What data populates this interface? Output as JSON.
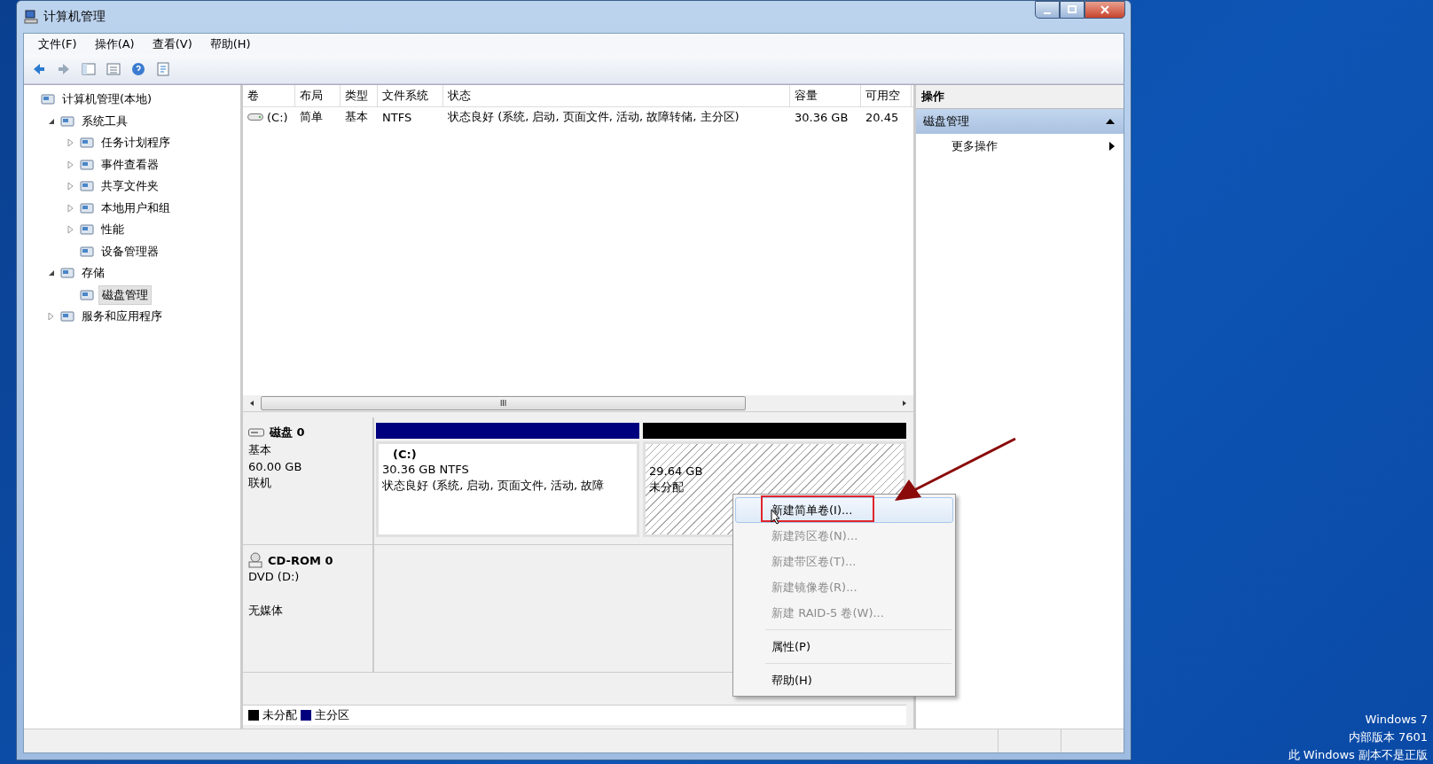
{
  "window": {
    "title": "计算机管理"
  },
  "menu": [
    {
      "label": "文件(F)"
    },
    {
      "label": "操作(A)"
    },
    {
      "label": "查看(V)"
    },
    {
      "label": "帮助(H)"
    }
  ],
  "tree": [
    {
      "label": "计算机管理(本地)",
      "selected": false,
      "children": [
        {
          "label": "系统工具",
          "selected": false,
          "expanded": true,
          "children": [
            {
              "label": "任务计划程序",
              "selected": false,
              "expanded": false
            },
            {
              "label": "事件查看器",
              "selected": false,
              "expanded": false
            },
            {
              "label": "共享文件夹",
              "selected": false,
              "expanded": false
            },
            {
              "label": "本地用户和组",
              "selected": false,
              "expanded": false
            },
            {
              "label": "性能",
              "selected": false,
              "expanded": false
            },
            {
              "label": "设备管理器",
              "selected": false
            }
          ]
        },
        {
          "label": "存储",
          "selected": false,
          "expanded": true,
          "children": [
            {
              "label": "磁盘管理",
              "selected": true
            }
          ]
        },
        {
          "label": "服务和应用程序",
          "selected": false,
          "expanded": false
        }
      ]
    }
  ],
  "volume_table": {
    "columns": [
      "卷",
      "布局",
      "类型",
      "文件系统",
      "状态",
      "容量",
      "可用空"
    ],
    "rows": [
      [
        "(C:)",
        "简单",
        "基本",
        "NTFS",
        "状态良好 (系统, 启动, 页面文件, 活动, 故障转储, 主分区)",
        "30.36 GB",
        "20.45"
      ]
    ]
  },
  "scrollbar_thumb": "III",
  "disks": [
    {
      "kind": "disk",
      "name": "磁盘 0",
      "type": "基本",
      "size": "60.00 GB",
      "state": "联机",
      "partitions": [
        {
          "kind": "primary",
          "color": "#00007f",
          "label": "(C:)",
          "size": "30.36 GB NTFS",
          "status": "状态良好 (系统, 启动, 页面文件, 活动, 故障"
        },
        {
          "kind": "unallocated",
          "color": "#000000",
          "size": "29.64 GB",
          "status": "未分配"
        }
      ]
    },
    {
      "kind": "cdrom",
      "name": "CD-ROM 0",
      "type": "DVD (D:)",
      "state": "无媒体"
    }
  ],
  "legend": [
    {
      "label": "未分配",
      "color": "#000000"
    },
    {
      "label": "主分区",
      "color": "#00007f"
    }
  ],
  "actions": {
    "header": "操作",
    "section": "磁盘管理",
    "items": [
      "更多操作"
    ]
  },
  "context_menu": [
    {
      "label": "新建简单卷(I)...",
      "selected": true,
      "disabled": false,
      "separator_before": false
    },
    {
      "label": "新建跨区卷(N)...",
      "selected": false,
      "disabled": true,
      "separator_before": false
    },
    {
      "label": "新建带区卷(T)...",
      "selected": false,
      "disabled": true,
      "separator_before": false
    },
    {
      "label": "新建镜像卷(R)...",
      "selected": false,
      "disabled": true,
      "separator_before": false
    },
    {
      "label": "新建 RAID-5 卷(W)...",
      "selected": false,
      "disabled": true,
      "separator_before": false
    },
    {
      "label": "属性(P)",
      "selected": false,
      "disabled": false,
      "separator_before": true
    },
    {
      "label": "帮助(H)",
      "selected": false,
      "disabled": false,
      "separator_before": true
    }
  ],
  "desktop_notice": [
    "Windows 7",
    "内部版本 7601",
    "此 Windows 副本不是正版"
  ]
}
